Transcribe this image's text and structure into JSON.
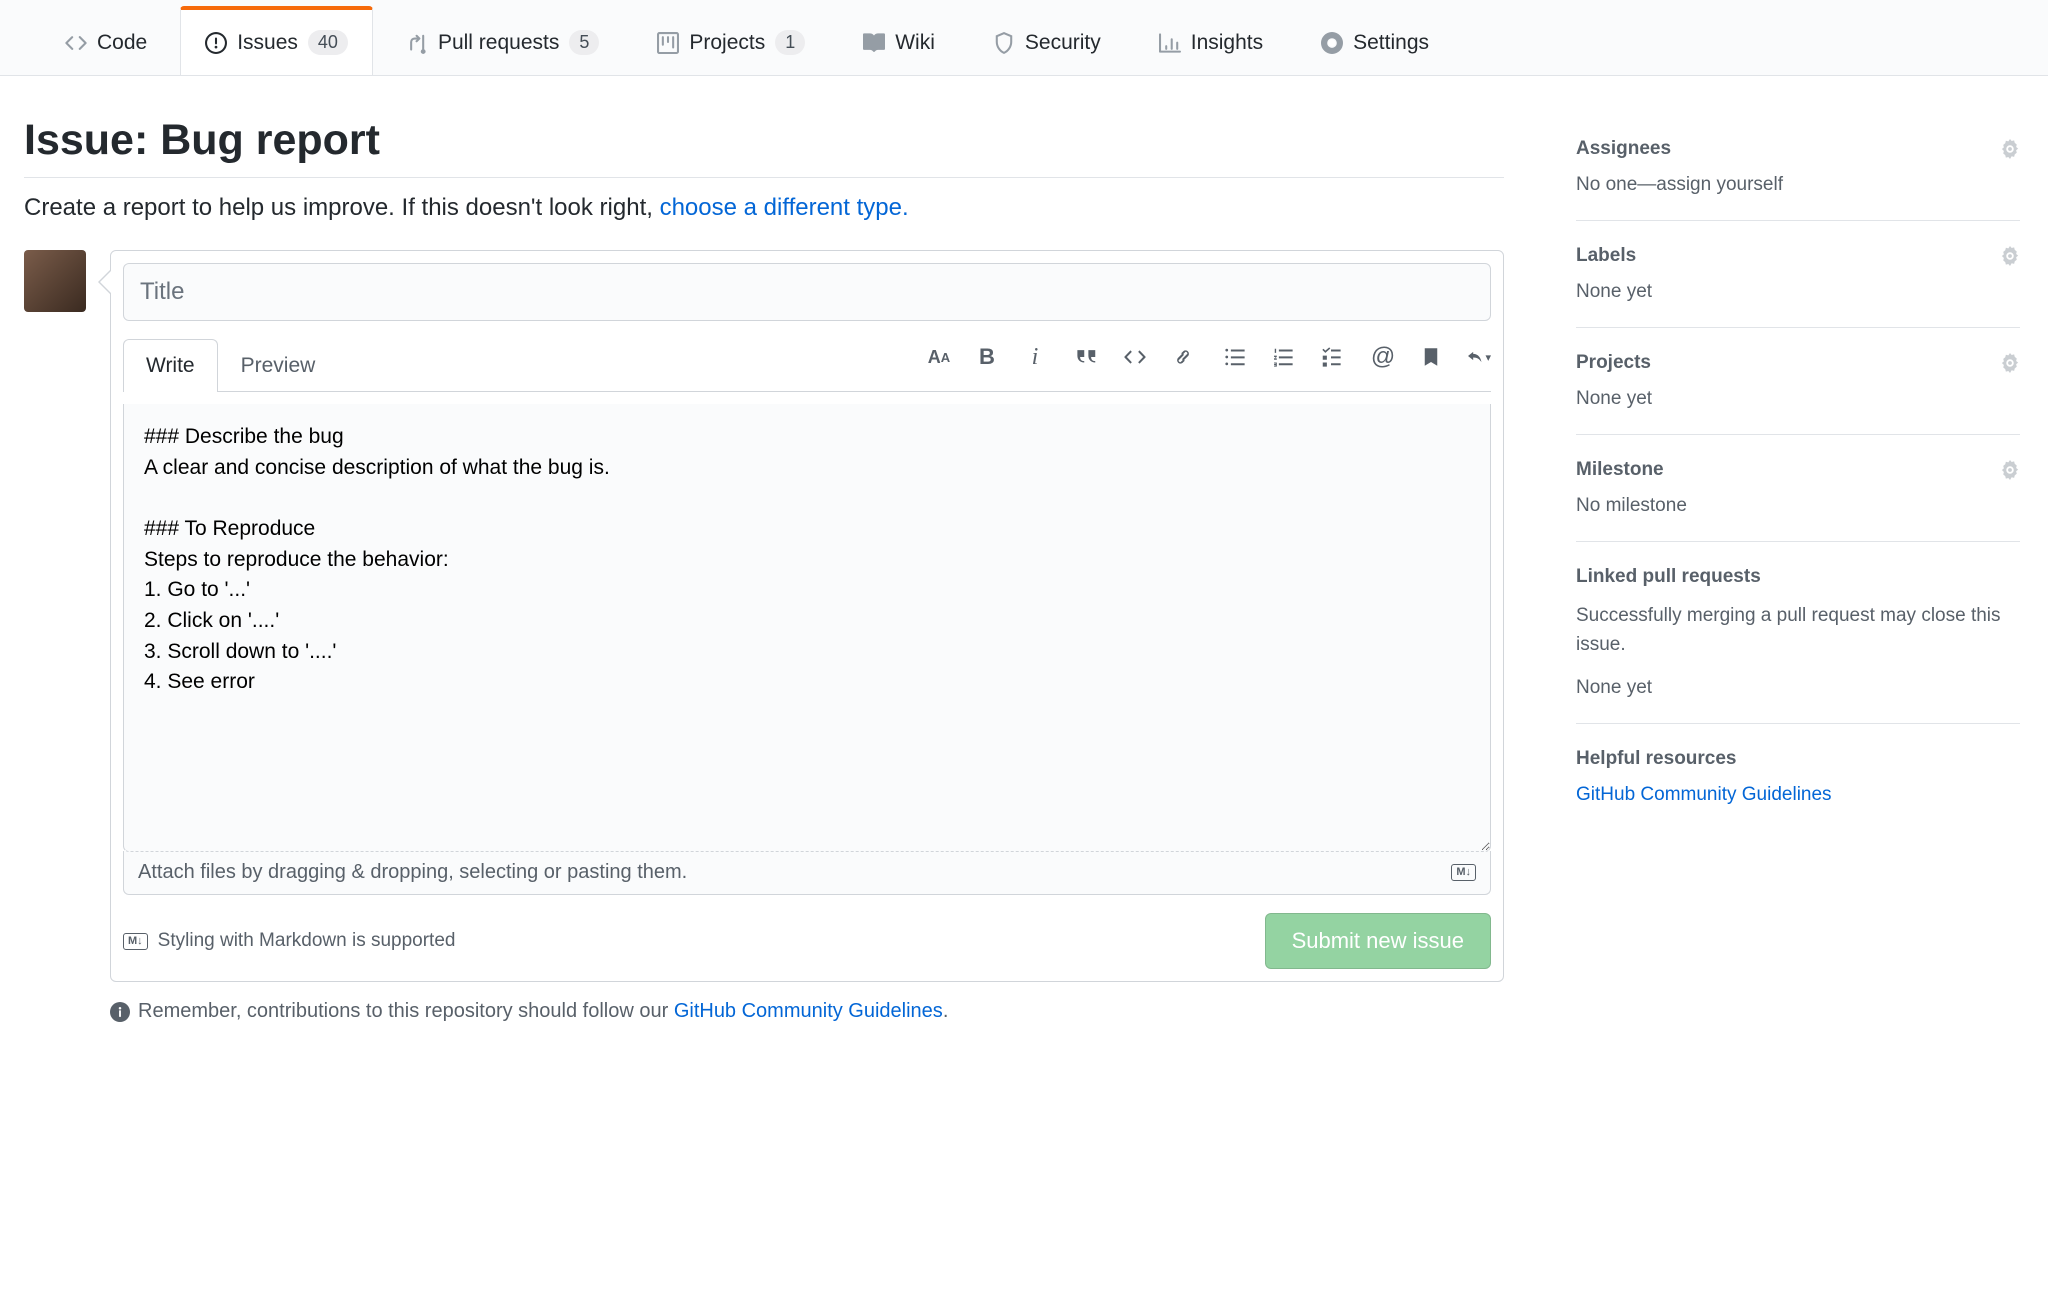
{
  "tabs": [
    {
      "label": "Code",
      "count": null
    },
    {
      "label": "Issues",
      "count": "40"
    },
    {
      "label": "Pull requests",
      "count": "5"
    },
    {
      "label": "Projects",
      "count": "1"
    },
    {
      "label": "Wiki",
      "count": null
    },
    {
      "label": "Security",
      "count": null
    },
    {
      "label": "Insights",
      "count": null
    },
    {
      "label": "Settings",
      "count": null
    }
  ],
  "page": {
    "title": "Issue: Bug report",
    "subtitle_prefix": "Create a report to help us improve. If this doesn't look right, ",
    "subtitle_link": "choose a different type."
  },
  "form": {
    "title_placeholder": "Title",
    "write_tab": "Write",
    "preview_tab": "Preview",
    "body_value": "### Describe the bug\nA clear and concise description of what the bug is.\n\n### To Reproduce\nSteps to reproduce the behavior:\n1. Go to '...'\n2. Click on '....'\n3. Scroll down to '....'\n4. See error\n",
    "attach_hint": "Attach files by dragging & dropping, selecting or pasting them.",
    "md_support": "Styling with Markdown is supported",
    "submit": "Submit new issue"
  },
  "contrib": {
    "prefix": "Remember, contributions to this repository should follow our ",
    "link": "GitHub Community Guidelines",
    "suffix": "."
  },
  "sidebar": {
    "assignees": {
      "title": "Assignees",
      "body": "No one—assign yourself"
    },
    "labels": {
      "title": "Labels",
      "body": "None yet"
    },
    "projects": {
      "title": "Projects",
      "body": "None yet"
    },
    "milestone": {
      "title": "Milestone",
      "body": "No milestone"
    },
    "linkedpr": {
      "title": "Linked pull requests",
      "desc": "Successfully merging a pull request may close this issue.",
      "body": "None yet"
    },
    "helpful": {
      "title": "Helpful resources",
      "link": "GitHub Community Guidelines"
    }
  }
}
